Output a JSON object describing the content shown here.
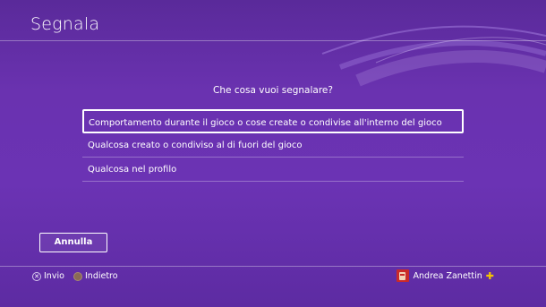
{
  "header": {
    "title": "Segnala"
  },
  "dialog": {
    "question": "Che cosa vuoi segnalare?",
    "options": [
      {
        "label": "Comportamento durante il gioco o cose create o condivise all'interno del gioco",
        "selected": true
      },
      {
        "label": "Qualcosa creato o condiviso al di fuori del gioco",
        "selected": false
      },
      {
        "label": "Qualcosa nel profilo",
        "selected": false
      }
    ],
    "cancel_label": "Annulla"
  },
  "footer": {
    "confirm_hint": "Invio",
    "back_hint": "Indietro",
    "user_name": "Andrea Zanettin",
    "plus_icon": "ps-plus-icon"
  },
  "colors": {
    "accent_plus": "#f5c400",
    "avatar_bg": "#c92a2a"
  }
}
